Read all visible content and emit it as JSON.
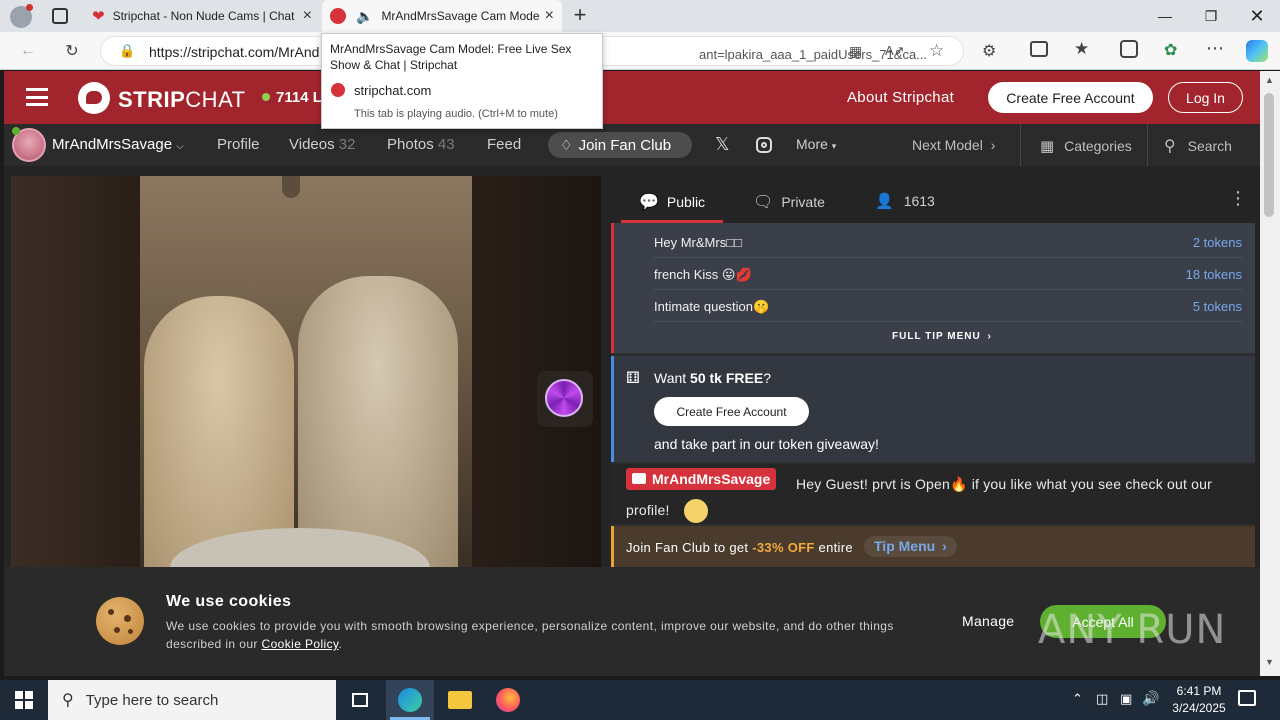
{
  "browser": {
    "tabs": [
      {
        "title": "Stripchat - Non Nude Cams | Chat"
      },
      {
        "title": "MrAndMrsSavage Cam Model: Free"
      }
    ],
    "url_prefix": "https://stripchat.com/MrAnd",
    "url_suffix": "ant=lpakira_aaa_1_paidUsers_71&ca..."
  },
  "tooltip": {
    "title": "MrAndMrsSavage Cam Model: Free Live Sex Show & Chat | Stripchat",
    "domain": "stripchat.com",
    "note": "This tab is playing audio. (Ctrl+M to mute)"
  },
  "site": {
    "logo_bold": "STRIP",
    "logo_light": "CHAT",
    "online_count": "7114 L",
    "about": "About Stripchat",
    "create_account": "Create Free Account",
    "login": "Log In"
  },
  "model": {
    "name": "MrAndMrsSavage",
    "nav": {
      "profile": "Profile",
      "videos": "Videos",
      "videos_count": "32",
      "photos": "Photos",
      "photos_count": "43",
      "feed": "Feed",
      "join_fan_club": "Join Fan Club",
      "more": "More",
      "next_model": "Next Model",
      "categories": "Categories",
      "search": "Search"
    }
  },
  "chat": {
    "tabs": {
      "public": "Public",
      "private": "Private",
      "viewers": "1613"
    },
    "tip_menu": [
      {
        "name": "Hey Mr&Mrs□□",
        "price": "2 tokens"
      },
      {
        "name": "french Kiss 😛💋",
        "price": "18 tokens"
      },
      {
        "name": "Intimate question🤫",
        "price": "5 tokens"
      }
    ],
    "full_tip_menu": "FULL TIP MENU",
    "giveaway": {
      "prefix": "Want ",
      "bold": "50 tk FREE",
      "suffix": "?",
      "button": "Create Free Account",
      "tail": "and take part in our token giveaway!"
    },
    "message": {
      "author": "MrAndMrsSavage",
      "text": "Hey Guest! prvt is Open🔥 if you like what you see check out our profile!"
    },
    "fanclub": {
      "prefix": "Join Fan Club to get ",
      "discount": "-33% OFF",
      "middle": " entire",
      "link": "Tip Menu"
    }
  },
  "cookie": {
    "title": "We use cookies",
    "text": "We use cookies to provide you with smooth browsing experience, personalize content, improve our website, and do other things described in our ",
    "policy": "Cookie Policy",
    "period": ".",
    "manage": "Manage",
    "accept": "Accept All"
  },
  "taskbar": {
    "search_placeholder": "Type here to search",
    "time": "6:41 PM",
    "date": "3/24/2025"
  },
  "watermark": "ANY RUN",
  "colors": {
    "brand": "#a2252d",
    "accept": "#5fb030",
    "token_link": "#79a7e8",
    "fan_discount": "#f2a93b"
  }
}
